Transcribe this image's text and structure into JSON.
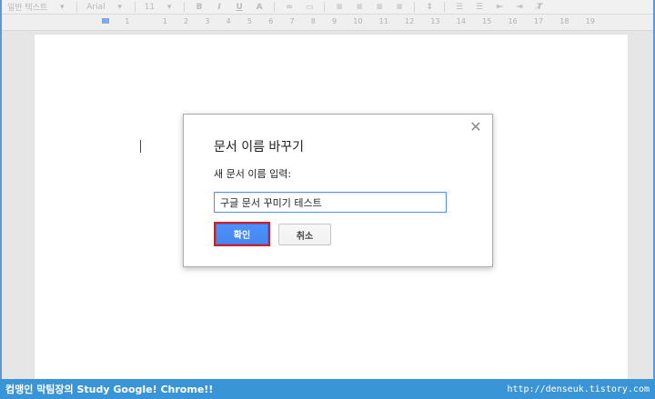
{
  "toolbar": {
    "style": "일반 텍스트",
    "font": "Arial",
    "size": "11"
  },
  "ruler": {
    "ticks": [
      "2",
      "1",
      "",
      "1",
      "2",
      "3",
      "4",
      "5",
      "6",
      "7",
      "8",
      "9",
      "10",
      "11",
      "12",
      "13",
      "14",
      "15",
      "16",
      "17",
      "18",
      "19"
    ]
  },
  "dialog": {
    "title": "문서 이름 바꾸기",
    "label": "새 문서 이름 입력:",
    "input_value": "구글 문서 꾸미기 테스트",
    "ok_label": "확인",
    "cancel_label": "취소",
    "close_glyph": "✕"
  },
  "banner": {
    "left_text": "컴맹인 막팀장의 Study Google! Chrome!!",
    "right_text": "http://denseuk.tistory.com"
  },
  "colors": {
    "accent": "#4d90fe",
    "highlight_border": "#e01818",
    "banner": "#3a95d7"
  }
}
